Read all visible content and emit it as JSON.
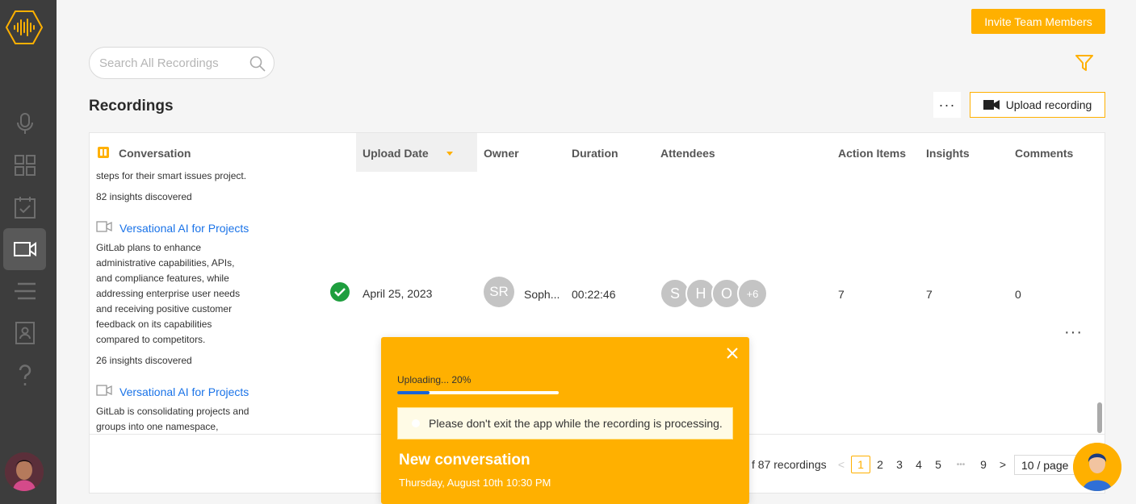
{
  "header": {
    "invite_label": "Invite Team Members",
    "search_placeholder": "Search All Recordings",
    "page_title": "Recordings",
    "more_label": "···",
    "upload_label": "Upload recording"
  },
  "sidebar": {
    "items": [
      {
        "name": "mic-icon"
      },
      {
        "name": "dashboard-icon"
      },
      {
        "name": "calendar-check-icon"
      },
      {
        "name": "video-icon",
        "active": true
      },
      {
        "name": "list-icon"
      },
      {
        "name": "contacts-icon"
      },
      {
        "name": "help-icon"
      }
    ]
  },
  "table": {
    "columns": {
      "conversation": "Conversation",
      "upload_date": "Upload Date",
      "owner": "Owner",
      "duration": "Duration",
      "attendees": "Attendees",
      "action_items": "Action Items",
      "insights": "Insights",
      "comments": "Comments"
    },
    "prev_row": {
      "tail_text": "steps for their smart issues project.",
      "insights": "82 insights discovered"
    },
    "rows": [
      {
        "title": "Versational AI for Projects",
        "summary": [
          "GitLab plans to enhance",
          "administrative capabilities, APIs,",
          "and compliance features, while",
          "addressing enterprise user needs",
          "and receiving positive customer",
          "feedback on its capabilities",
          "compared to competitors."
        ],
        "insights": "26 insights discovered",
        "upload_date": "April 25, 2023",
        "owner_initials": "SR",
        "owner_name": "Soph...",
        "duration": "00:22:46",
        "attendees": [
          "S",
          "H",
          "O",
          "+6"
        ],
        "action_items": "7",
        "insights_count": "7",
        "comments": "0",
        "row_more": "···"
      },
      {
        "title": "Versational AI for Projects",
        "summary": [
          "GitLab is consolidating projects and",
          "groups into one namespace,"
        ]
      }
    ]
  },
  "pagination": {
    "total_text": "f 87 recordings",
    "pages": [
      "1",
      "2",
      "3",
      "4",
      "5",
      "•••",
      "9"
    ],
    "active_page": "1",
    "prev": "<",
    "next": ">",
    "page_size": "10 / page"
  },
  "toast": {
    "status": "Uploading... 20%",
    "progress": 0.2,
    "warning": "Please don't exit the app while the recording is processing.",
    "title": "New conversation",
    "date": "Thursday, August 10th 10:30 PM"
  },
  "colors": {
    "accent": "#ffb000",
    "sidebar": "#3d3d3d",
    "link": "#1a73e8",
    "progress": "#1a63d6",
    "success": "#1e9e3e"
  }
}
